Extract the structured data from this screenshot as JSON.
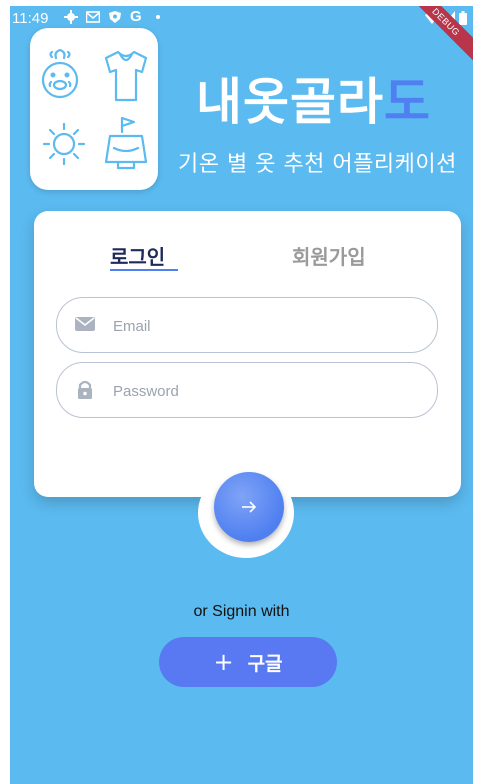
{
  "status_bar": {
    "time": "11:49",
    "g_label": "G",
    "debug_label": "DEBUG"
  },
  "app": {
    "title_main": "내옷골라",
    "title_accent": "도",
    "subtitle": "기온 별 옷 추천 어플리케이션"
  },
  "tabs": {
    "login": "로그인",
    "signup": "회원가입"
  },
  "form": {
    "email_placeholder": "Email",
    "password_placeholder": "Password",
    "email_value": "",
    "password_value": ""
  },
  "submit": {
    "icon": "arrow-right-icon"
  },
  "social": {
    "or_text": "or Signin with",
    "google_plus": "+",
    "google_label": "구글"
  },
  "colors": {
    "background": "#5bbaf0",
    "accent": "#4f7ff0",
    "google_button": "#5879f2",
    "debug_banner": "#b8354a"
  }
}
